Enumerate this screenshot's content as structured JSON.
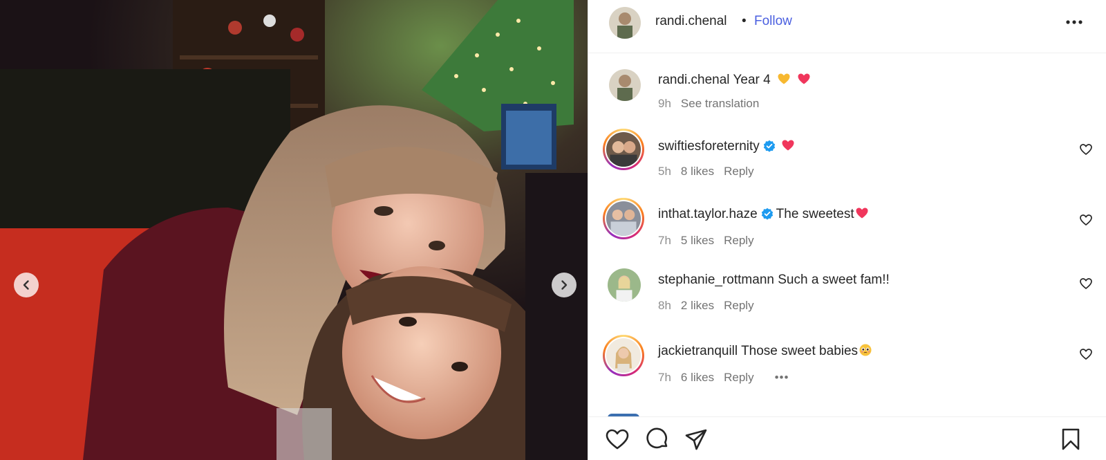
{
  "post": {
    "author": "randi.chenal",
    "separator": "•",
    "follow_label": "Follow",
    "caption": {
      "username": "randi.chenal",
      "text": "Year 4",
      "time": "9h",
      "see_translation": "See translation"
    }
  },
  "comments": [
    {
      "username": "swiftiesforeternity",
      "verified": true,
      "text": "",
      "time": "5h",
      "likes": "8 likes",
      "reply": "Reply"
    },
    {
      "username": "inthat.taylor.haze",
      "verified": true,
      "text": "The sweetest",
      "time": "7h",
      "likes": "5 likes",
      "reply": "Reply"
    },
    {
      "username": "stephanie_rottmann",
      "verified": false,
      "text": "Such a sweet fam!!",
      "time": "8h",
      "likes": "2 likes",
      "reply": "Reply"
    },
    {
      "username": "jackietranquill",
      "verified": false,
      "text": "Those sweet babies",
      "time": "7h",
      "likes": "6 likes",
      "reply": "Reply",
      "more": "•••"
    }
  ],
  "icons": {
    "more": "more-horizontal-icon",
    "prev": "chevron-left-icon",
    "next": "chevron-right-icon",
    "like": "heart-icon",
    "comment": "comment-icon",
    "share": "share-icon",
    "save": "bookmark-icon",
    "verified": "verified-badge-icon"
  },
  "colors": {
    "follow": "#4a5fe0",
    "verified": "#1d9bf0",
    "heart_emoji": "#f0365c",
    "yellow_heart": "#f7b830"
  }
}
